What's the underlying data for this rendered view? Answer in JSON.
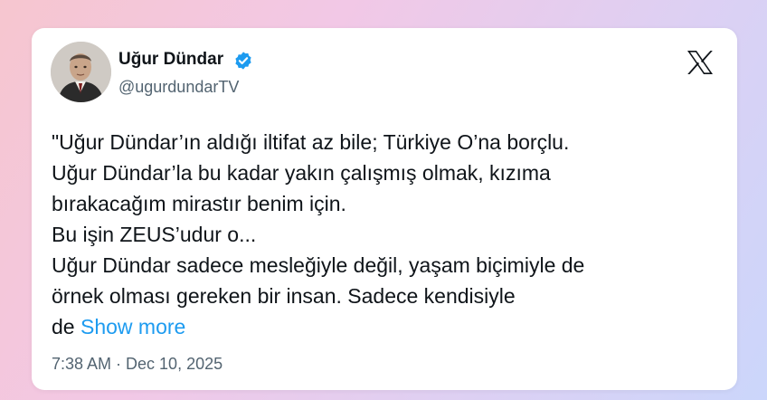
{
  "author": {
    "name": "Uğur Dündar",
    "handle": "@ugurdundarTV"
  },
  "icons": {
    "verified": "verified-badge-icon",
    "platform": "x-logo-icon"
  },
  "colors": {
    "verified_blue": "#1d9bf0",
    "link_blue": "#1d9bf0",
    "secondary_text": "#536471",
    "primary_text": "#0f1419"
  },
  "tweet": {
    "lines": [
      "\"Uğur Dündar’ın aldığı iltifat az bile; Türkiye O’na borçlu.",
      "Uğur Dündar’la bu kadar yakın çalışmış olmak, kızıma",
      "bırakacağım mirastır benim için.",
      "Bu işin ZEUS’udur o...",
      "Uğur Dündar sadece mesleğiyle değil, yaşam biçimiyle de",
      "örnek olması gereken bir insan. Sadece kendisiyle",
      "de"
    ],
    "show_more": "Show more"
  },
  "timestamp": "7:38 AM · Dec 10, 2025"
}
